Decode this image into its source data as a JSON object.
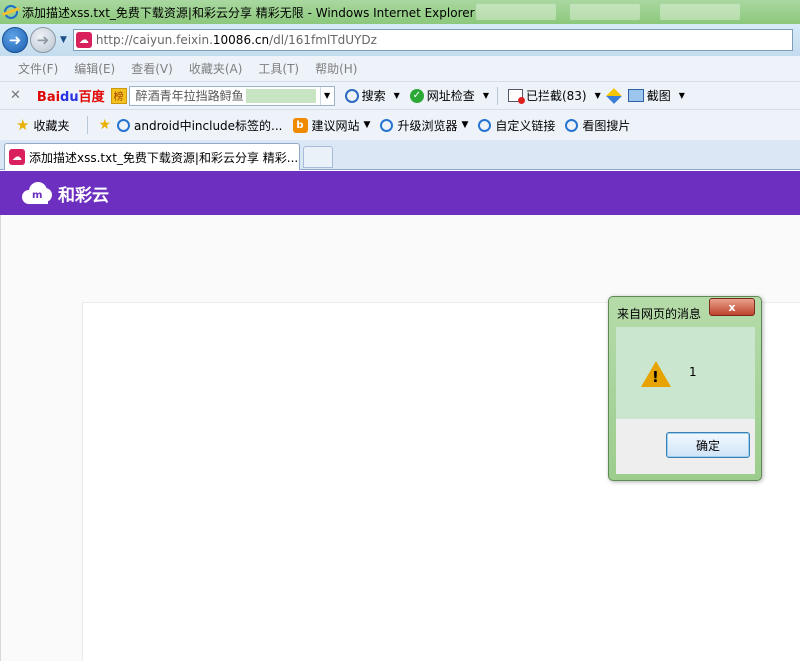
{
  "window": {
    "title": "添加描述xss.txt_免费下载资源|和彩云分享 精彩无限 - Windows Internet Explorer"
  },
  "address": {
    "url_prefix": "http://caiyun.feixin.",
    "url_host": "10086.cn",
    "url_path": "/dl/161fmlTdUYDz"
  },
  "menu": {
    "items": [
      "文件(F)",
      "编辑(E)",
      "查看(V)",
      "收藏夹(A)",
      "工具(T)",
      "帮助(H)"
    ]
  },
  "baidu_toolbar": {
    "logo_bai": "Bai",
    "logo_du": "du",
    "logo_baidu": "百度",
    "bang_icon": "榜",
    "search_value": "醉酒青年拉挡路鲟鱼",
    "search_label": "搜索",
    "check_label": "网址检查",
    "blocked_label": "已拦截(83)",
    "screenshot_label": "截图"
  },
  "favorites": {
    "folder_label": "收藏夹",
    "items": [
      {
        "label": "android中include标签的...",
        "icon": "ie-icon"
      },
      {
        "label": "建议网站",
        "icon": "bing-icon"
      },
      {
        "label": "升级浏览器",
        "icon": "ie-icon"
      },
      {
        "label": "自定义链接",
        "icon": "ie-icon"
      },
      {
        "label": "看图搜片",
        "icon": "ie-icon"
      }
    ]
  },
  "tab": {
    "label": "添加描述xss.txt_免费下载资源|和彩云分享 精彩..."
  },
  "site": {
    "brand": "和彩云"
  },
  "dialog": {
    "title": "来自网页的消息",
    "close": "x",
    "message": "1",
    "ok_label": "确定"
  },
  "colors": {
    "header_purple": "#6c2fc0",
    "dialog_green": "#b5dba9",
    "content_green": "#cbe6cf"
  }
}
